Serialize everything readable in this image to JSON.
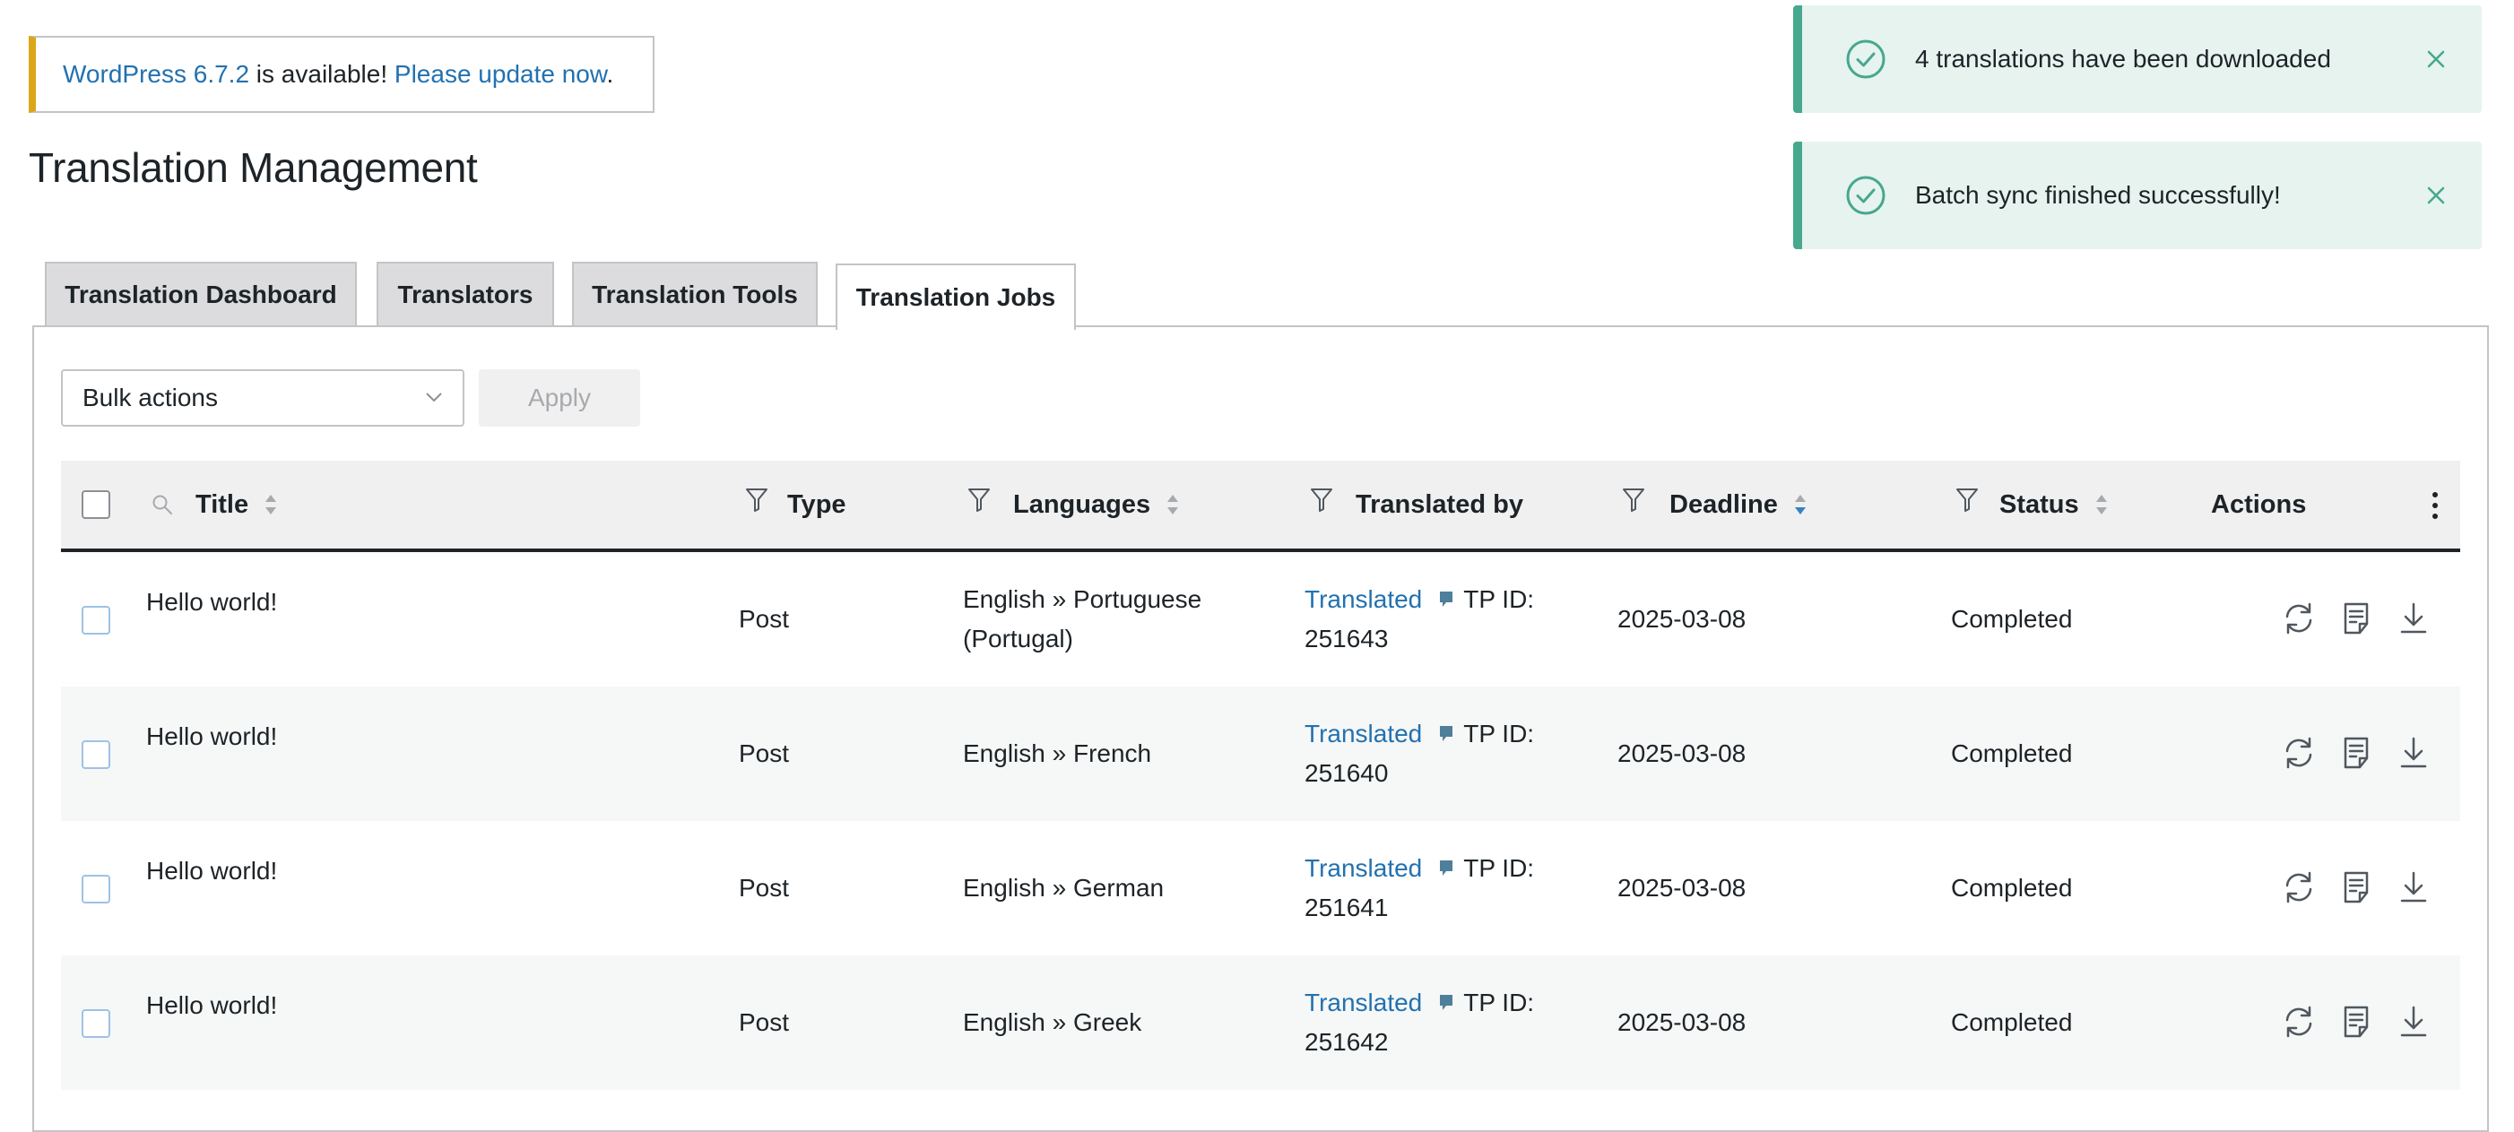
{
  "update_notice": {
    "version_link": "WordPress 6.7.2",
    "middle_text": " is available! ",
    "update_link": "Please update now",
    "end_text": "."
  },
  "page_title": "Translation Management",
  "toasts": [
    {
      "message": "4 translations have been downloaded"
    },
    {
      "message": "Batch sync finished successfully!"
    }
  ],
  "tabs": [
    {
      "label": "Translation Dashboard",
      "active": false
    },
    {
      "label": "Translators",
      "active": false
    },
    {
      "label": "Translation Tools",
      "active": false
    },
    {
      "label": "Translation Jobs",
      "active": true
    }
  ],
  "bulk_actions": {
    "selected": "Bulk actions",
    "apply_label": "Apply"
  },
  "table": {
    "columns": {
      "title": "Title",
      "type": "Type",
      "languages": "Languages",
      "translated_by": "Translated by",
      "deadline": "Deadline",
      "status": "Status",
      "actions": "Actions"
    },
    "rows": [
      {
        "title": "Hello world!",
        "type": "Post",
        "languages_line1": "English » Portuguese",
        "languages_line2": "(Portugal)",
        "translator_link": "Translated",
        "tp_label": "TP ID:",
        "tp_id": "251643",
        "deadline": "2025-03-08",
        "status": "Completed"
      },
      {
        "title": "Hello world!",
        "type": "Post",
        "languages_line1": "English » French",
        "languages_line2": "",
        "translator_link": "Translated",
        "tp_label": "TP ID:",
        "tp_id": "251640",
        "deadline": "2025-03-08",
        "status": "Completed"
      },
      {
        "title": "Hello world!",
        "type": "Post",
        "languages_line1": "English » German",
        "languages_line2": "",
        "translator_link": "Translated",
        "tp_label": "TP ID:",
        "tp_id": "251641",
        "deadline": "2025-03-08",
        "status": "Completed"
      },
      {
        "title": "Hello world!",
        "type": "Post",
        "languages_line1": "English » Greek",
        "languages_line2": "",
        "translator_link": "Translated",
        "tp_label": "TP ID:",
        "tp_id": "251642",
        "deadline": "2025-03-08",
        "status": "Completed"
      }
    ]
  },
  "icons": {
    "toast": "check-circle-icon",
    "dismiss": "close-icon",
    "search": "search-icon",
    "filter": "filter-icon",
    "sort": "sort-icon",
    "row_actions": [
      "sync-icon",
      "document-icon",
      "download-icon"
    ],
    "more": "kebab-menu-icon"
  },
  "colors": {
    "link": "#2271b1",
    "toast_bg": "#e7f3ef",
    "toast_accent": "#46a88e",
    "notice_accent": "#dba617",
    "sort_active": "#3582c4"
  }
}
